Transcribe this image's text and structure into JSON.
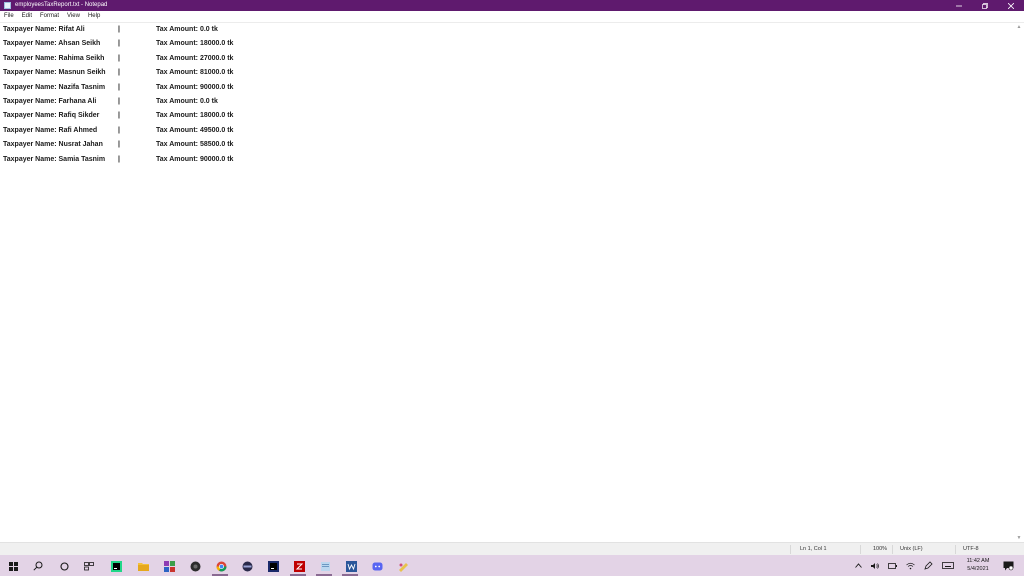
{
  "window": {
    "title": "employeesTaxReport.txt - Notepad"
  },
  "menu": [
    "File",
    "Edit",
    "Format",
    "View",
    "Help"
  ],
  "document": {
    "lines": [
      {
        "name": "Taxpayer Name: Rifat Ali",
        "sep": "|",
        "tax": "Tax Amount: 0.0 tk"
      },
      {
        "name": "Taxpayer Name: Ahsan Seikh",
        "sep": "|",
        "tax": "Tax Amount: 18000.0 tk"
      },
      {
        "name": "Taxpayer Name: Rahima Seikh",
        "sep": "|",
        "tax": "Tax Amount: 27000.0 tk"
      },
      {
        "name": "Taxpayer Name: Masnun Seikh",
        "sep": "|",
        "tax": "Tax Amount: 81000.0 tk"
      },
      {
        "name": "Taxpayer Name: Nazifa Tasnim",
        "sep": "|",
        "tax": "Tax Amount: 90000.0 tk"
      },
      {
        "name": "Taxpayer Name: Farhana Ali",
        "sep": "|",
        "tax": "Tax Amount: 0.0 tk"
      },
      {
        "name": "Taxpayer Name: Rafiq Sikder",
        "sep": "|",
        "tax": "Tax Amount: 18000.0 tk"
      },
      {
        "name": "Taxpayer Name: Rafi Ahmed",
        "sep": "|",
        "tax": "Tax Amount: 49500.0 tk"
      },
      {
        "name": "Taxpayer Name: Nusrat Jahan",
        "sep": "|",
        "tax": "Tax Amount: 58500.0 tk"
      },
      {
        "name": "Taxpayer Name: Samia Tasnim",
        "sep": "|",
        "tax": "Tax Amount: 90000.0 tk"
      }
    ]
  },
  "status": {
    "position": "Ln 1, Col 1",
    "zoom": "100%",
    "line_ending": "Unix (LF)",
    "encoding": "UTF-8"
  },
  "taskbar": {
    "apps": [
      "start-icon",
      "search-icon",
      "cortana-icon",
      "task-view-icon",
      "pycharm-icon",
      "file-explorer-icon",
      "winrar-icon",
      "obs-icon",
      "chrome-icon",
      "media-player-icon",
      "intellij-icon",
      "filezilla-icon",
      "notepad-icon",
      "word-icon",
      "discord-icon",
      "paint-icon"
    ],
    "time": "11:42 AM",
    "date": "5/4/2021"
  },
  "colors": {
    "titlebar": "#5f1a6e",
    "taskbar": "#e3d3e6",
    "text": "#1a1a1a"
  }
}
